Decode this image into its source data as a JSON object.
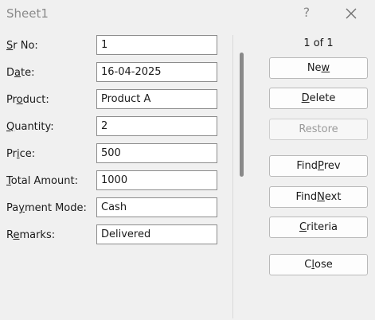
{
  "window": {
    "title": "Sheet1",
    "help_glyph": "?"
  },
  "fields": [
    {
      "pre": "",
      "key": "S",
      "post": "r No:",
      "value": "1"
    },
    {
      "pre": "D",
      "key": "a",
      "post": "te:",
      "value": "16-04-2025"
    },
    {
      "pre": "Pr",
      "key": "o",
      "post": "duct:",
      "value": "Product A"
    },
    {
      "pre": "",
      "key": "Q",
      "post": "uantity:",
      "value": "2"
    },
    {
      "pre": "Pr",
      "key": "i",
      "post": "ce:",
      "value": "500"
    },
    {
      "pre": "",
      "key": "T",
      "post": "otal Amount:",
      "value": "1000"
    },
    {
      "pre": "Pa",
      "key": "y",
      "post": "ment Mode:",
      "value": "Cash"
    },
    {
      "pre": "R",
      "key": "e",
      "post": "marks:",
      "value": "Delivered"
    }
  ],
  "record_count": "1 of 1",
  "buttons": {
    "new": {
      "pre": "Ne",
      "key": "w",
      "post": ""
    },
    "delete": {
      "pre": "",
      "key": "D",
      "post": "elete"
    },
    "restore": {
      "pre": "",
      "key": "",
      "post": "Restore"
    },
    "find_prev": {
      "pre": "Find ",
      "key": "P",
      "post": "rev"
    },
    "find_next": {
      "pre": "Find ",
      "key": "N",
      "post": "ext"
    },
    "criteria": {
      "pre": "",
      "key": "C",
      "post": "riteria"
    },
    "close": {
      "pre": "C",
      "key": "l",
      "post": "ose"
    }
  }
}
